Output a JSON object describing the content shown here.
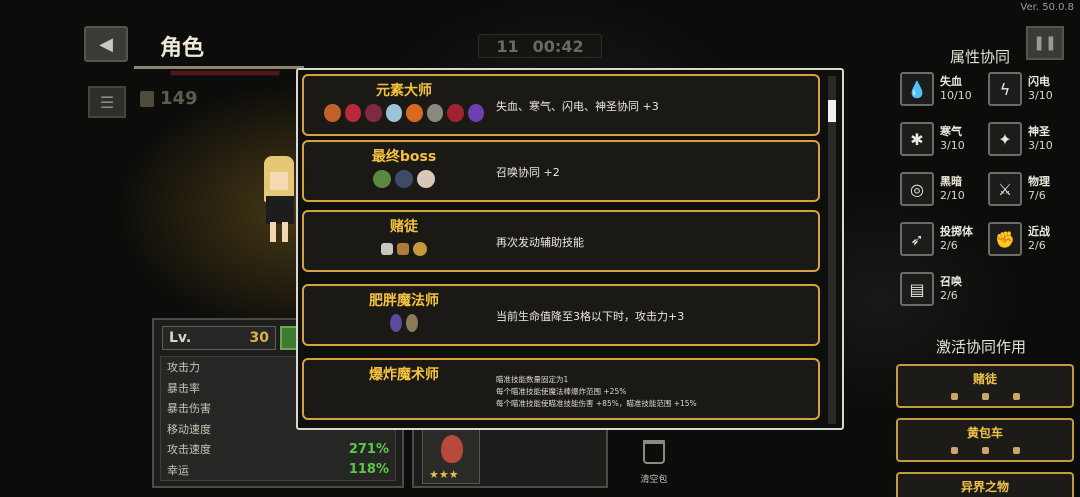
{
  "version": "Ver. 50.0.8",
  "header": {
    "title": "角色",
    "coins": "149",
    "timer_count": "11",
    "timer": "00:42"
  },
  "stats": {
    "level_label": "Lv.",
    "level": "30",
    "rows": [
      {
        "label": "攻击力",
        "value": ""
      },
      {
        "label": "暴击率",
        "value": ""
      },
      {
        "label": "暴击伤害",
        "value": ""
      },
      {
        "label": "移动速度",
        "value": ""
      },
      {
        "label": "攻击速度",
        "value": "271%"
      },
      {
        "label": "幸运",
        "value": "118%"
      }
    ]
  },
  "inventory": {
    "clear_label": "清空包"
  },
  "synergy_panel": {
    "title": "属性协同",
    "items": [
      {
        "name": "失血",
        "count": "10/10",
        "icon": "blood-drop-icon"
      },
      {
        "name": "闪电",
        "count": "3/10",
        "icon": "lightning-icon"
      },
      {
        "name": "寒气",
        "count": "3/10",
        "icon": "snowflake-icon"
      },
      {
        "name": "神圣",
        "count": "3/10",
        "icon": "holy-star-icon"
      },
      {
        "name": "黑暗",
        "count": "2/10",
        "icon": "dark-swirl-icon"
      },
      {
        "name": "物理",
        "count": "7/6",
        "icon": "sword-icon"
      },
      {
        "name": "投掷体",
        "count": "2/6",
        "icon": "projectile-icon"
      },
      {
        "name": "近战",
        "count": "2/6",
        "icon": "fist-icon"
      },
      {
        "name": "召唤",
        "count": "2/6",
        "icon": "book-icon"
      }
    ],
    "active_title": "激活协同作用",
    "active": [
      {
        "name": "赌徒"
      },
      {
        "name": "黄包车"
      },
      {
        "name": "异界之物"
      }
    ]
  },
  "modal": {
    "cards": [
      {
        "title": "元素大师",
        "desc": "失血、寒气、闪电、神圣协同 +3"
      },
      {
        "title": "最终boss",
        "desc": "召唤协同 +2"
      },
      {
        "title": "赌徒",
        "desc": "再次发动辅助技能"
      },
      {
        "title": "肥胖魔法师",
        "desc": "当前生命值降至3格以下时，攻击力+3"
      },
      {
        "title": "爆炸魔术师",
        "desc_lines": [
          "瞄准技能数量固定为1",
          "每个瞄准技能使魔法棒爆炸范围 +25%",
          "每个瞄准技能使瞄准技能伤害 +85%，瞄准技能范围 +15%"
        ]
      }
    ]
  },
  "colors": {
    "accent_gold": "#d6a23e",
    "title_gold": "#f5c33b",
    "stat_green": "#5cc84a"
  }
}
